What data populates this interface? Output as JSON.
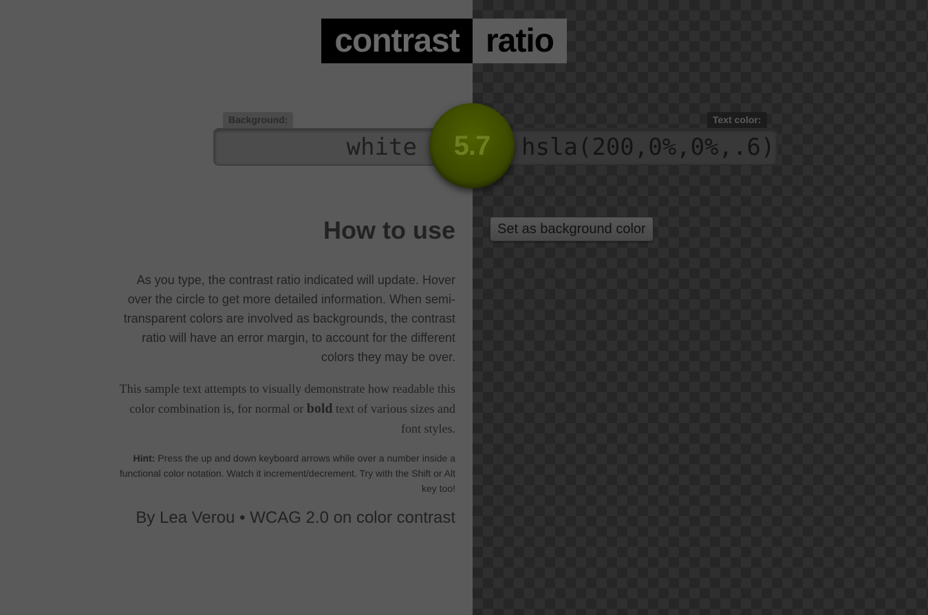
{
  "logo": {
    "word1": "contrast",
    "word2": "ratio"
  },
  "background_label": "Background:",
  "text_color_label": "Text color:",
  "background_value": "white",
  "text_color_value": "hsla(200,0%,0%,.6)",
  "ratio": "5.7",
  "swap_button": "Set as background color",
  "how_to": {
    "heading": "How to use",
    "intro": "As you type, the contrast ratio indicated will update. Hover over the circle to get more detailed information. When semi-transparent colors are involved as backgrounds, the contrast ratio will have an error margin, to account for the different colors they may be over.",
    "sample_before": "This sample text attempts to visually demonstrate how readable this color combination is, for normal or ",
    "sample_bold": "bold",
    "sample_after": " text of various sizes and font styles.",
    "hint_label": "Hint:",
    "hint_text": " Press the up and down keyboard arrows while over a number inside a functional color notation. Watch it increment/decrement. Try with the Shift or Alt key too!"
  },
  "credits": {
    "by": "By ",
    "author": "Lea Verou",
    "separator": " • ",
    "link": "WCAG 2.0 on color contrast"
  },
  "colors": {
    "ratio_circle": "#3c4a00",
    "left_background": "#5a5a5a",
    "right_background": "#2f2f2f"
  }
}
